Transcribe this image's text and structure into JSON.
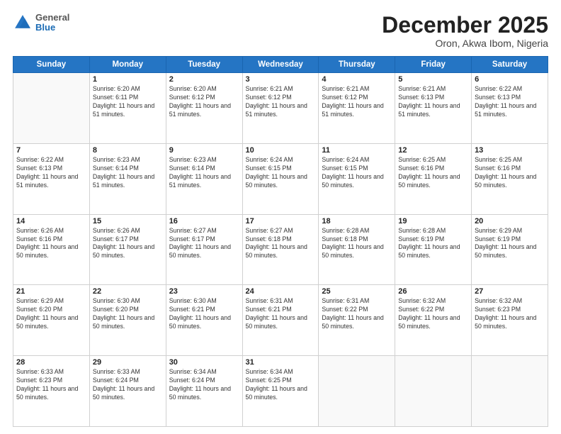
{
  "header": {
    "logo": {
      "general": "General",
      "blue": "Blue"
    },
    "title": "December 2025",
    "subtitle": "Oron, Akwa Ibom, Nigeria"
  },
  "calendar": {
    "days_of_week": [
      "Sunday",
      "Monday",
      "Tuesday",
      "Wednesday",
      "Thursday",
      "Friday",
      "Saturday"
    ],
    "weeks": [
      [
        {
          "day": "",
          "info": ""
        },
        {
          "day": "1",
          "info": "Sunrise: 6:20 AM\nSunset: 6:11 PM\nDaylight: 11 hours\nand 51 minutes."
        },
        {
          "day": "2",
          "info": "Sunrise: 6:20 AM\nSunset: 6:12 PM\nDaylight: 11 hours\nand 51 minutes."
        },
        {
          "day": "3",
          "info": "Sunrise: 6:21 AM\nSunset: 6:12 PM\nDaylight: 11 hours\nand 51 minutes."
        },
        {
          "day": "4",
          "info": "Sunrise: 6:21 AM\nSunset: 6:12 PM\nDaylight: 11 hours\nand 51 minutes."
        },
        {
          "day": "5",
          "info": "Sunrise: 6:21 AM\nSunset: 6:13 PM\nDaylight: 11 hours\nand 51 minutes."
        },
        {
          "day": "6",
          "info": "Sunrise: 6:22 AM\nSunset: 6:13 PM\nDaylight: 11 hours\nand 51 minutes."
        }
      ],
      [
        {
          "day": "7",
          "info": "Sunrise: 6:22 AM\nSunset: 6:13 PM\nDaylight: 11 hours\nand 51 minutes."
        },
        {
          "day": "8",
          "info": "Sunrise: 6:23 AM\nSunset: 6:14 PM\nDaylight: 11 hours\nand 51 minutes."
        },
        {
          "day": "9",
          "info": "Sunrise: 6:23 AM\nSunset: 6:14 PM\nDaylight: 11 hours\nand 51 minutes."
        },
        {
          "day": "10",
          "info": "Sunrise: 6:24 AM\nSunset: 6:15 PM\nDaylight: 11 hours\nand 50 minutes."
        },
        {
          "day": "11",
          "info": "Sunrise: 6:24 AM\nSunset: 6:15 PM\nDaylight: 11 hours\nand 50 minutes."
        },
        {
          "day": "12",
          "info": "Sunrise: 6:25 AM\nSunset: 6:16 PM\nDaylight: 11 hours\nand 50 minutes."
        },
        {
          "day": "13",
          "info": "Sunrise: 6:25 AM\nSunset: 6:16 PM\nDaylight: 11 hours\nand 50 minutes."
        }
      ],
      [
        {
          "day": "14",
          "info": "Sunrise: 6:26 AM\nSunset: 6:16 PM\nDaylight: 11 hours\nand 50 minutes."
        },
        {
          "day": "15",
          "info": "Sunrise: 6:26 AM\nSunset: 6:17 PM\nDaylight: 11 hours\nand 50 minutes."
        },
        {
          "day": "16",
          "info": "Sunrise: 6:27 AM\nSunset: 6:17 PM\nDaylight: 11 hours\nand 50 minutes."
        },
        {
          "day": "17",
          "info": "Sunrise: 6:27 AM\nSunset: 6:18 PM\nDaylight: 11 hours\nand 50 minutes."
        },
        {
          "day": "18",
          "info": "Sunrise: 6:28 AM\nSunset: 6:18 PM\nDaylight: 11 hours\nand 50 minutes."
        },
        {
          "day": "19",
          "info": "Sunrise: 6:28 AM\nSunset: 6:19 PM\nDaylight: 11 hours\nand 50 minutes."
        },
        {
          "day": "20",
          "info": "Sunrise: 6:29 AM\nSunset: 6:19 PM\nDaylight: 11 hours\nand 50 minutes."
        }
      ],
      [
        {
          "day": "21",
          "info": "Sunrise: 6:29 AM\nSunset: 6:20 PM\nDaylight: 11 hours\nand 50 minutes."
        },
        {
          "day": "22",
          "info": "Sunrise: 6:30 AM\nSunset: 6:20 PM\nDaylight: 11 hours\nand 50 minutes."
        },
        {
          "day": "23",
          "info": "Sunrise: 6:30 AM\nSunset: 6:21 PM\nDaylight: 11 hours\nand 50 minutes."
        },
        {
          "day": "24",
          "info": "Sunrise: 6:31 AM\nSunset: 6:21 PM\nDaylight: 11 hours\nand 50 minutes."
        },
        {
          "day": "25",
          "info": "Sunrise: 6:31 AM\nSunset: 6:22 PM\nDaylight: 11 hours\nand 50 minutes."
        },
        {
          "day": "26",
          "info": "Sunrise: 6:32 AM\nSunset: 6:22 PM\nDaylight: 11 hours\nand 50 minutes."
        },
        {
          "day": "27",
          "info": "Sunrise: 6:32 AM\nSunset: 6:23 PM\nDaylight: 11 hours\nand 50 minutes."
        }
      ],
      [
        {
          "day": "28",
          "info": "Sunrise: 6:33 AM\nSunset: 6:23 PM\nDaylight: 11 hours\nand 50 minutes."
        },
        {
          "day": "29",
          "info": "Sunrise: 6:33 AM\nSunset: 6:24 PM\nDaylight: 11 hours\nand 50 minutes."
        },
        {
          "day": "30",
          "info": "Sunrise: 6:34 AM\nSunset: 6:24 PM\nDaylight: 11 hours\nand 50 minutes."
        },
        {
          "day": "31",
          "info": "Sunrise: 6:34 AM\nSunset: 6:25 PM\nDaylight: 11 hours\nand 50 minutes."
        },
        {
          "day": "",
          "info": ""
        },
        {
          "day": "",
          "info": ""
        },
        {
          "day": "",
          "info": ""
        }
      ]
    ]
  }
}
